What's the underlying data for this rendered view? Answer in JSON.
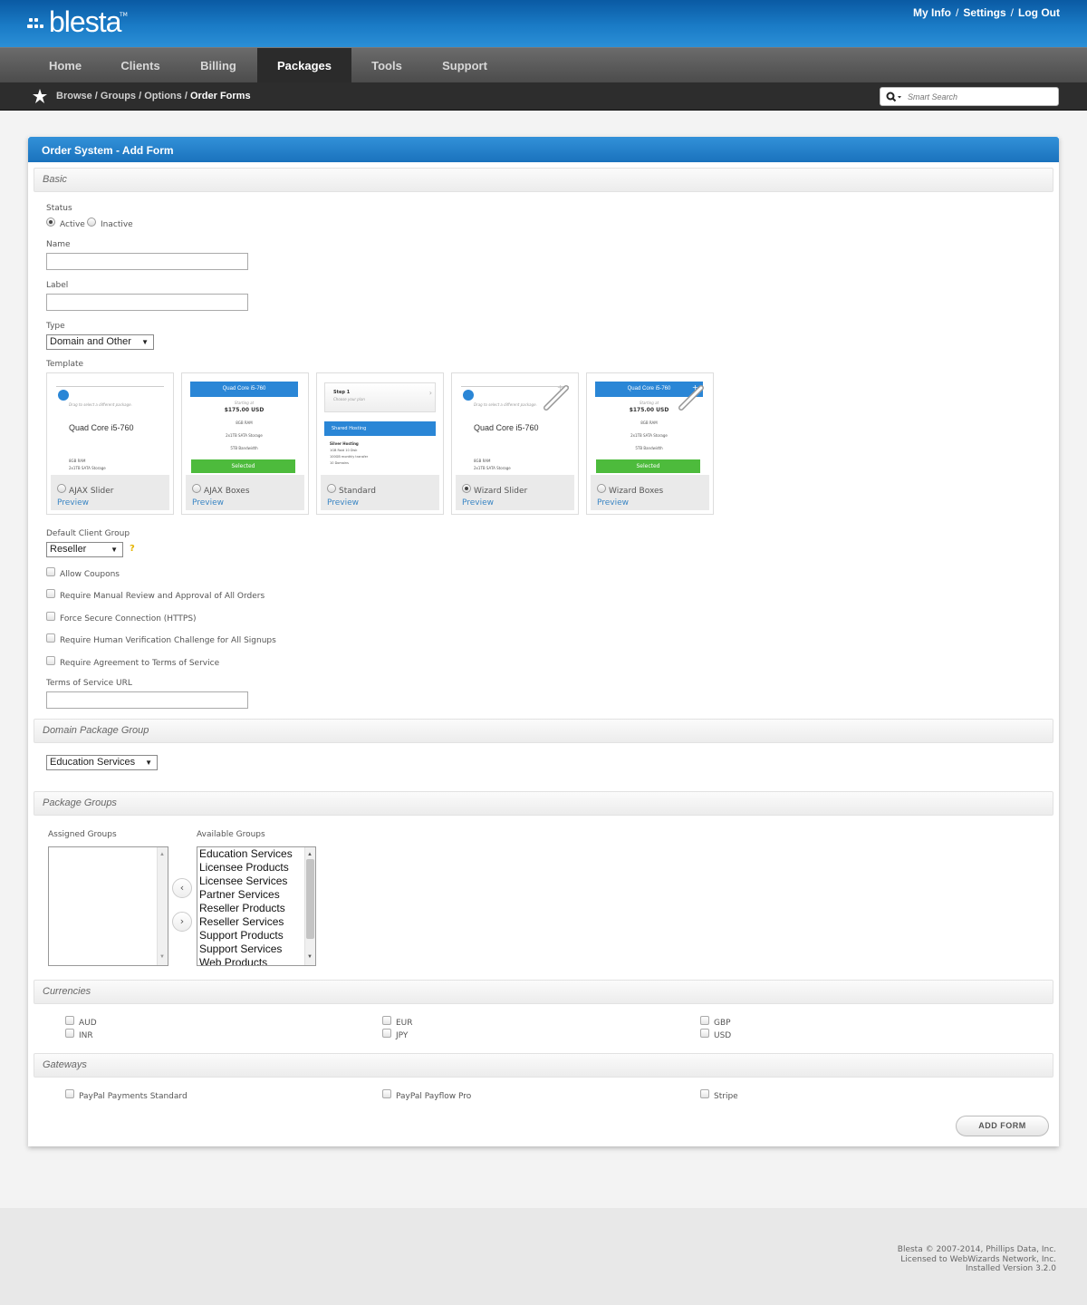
{
  "header": {
    "logo": "blesta",
    "logo_tm": "TM",
    "links": [
      "My Info",
      "Settings",
      "Log Out"
    ]
  },
  "nav": {
    "items": [
      "Home",
      "Clients",
      "Billing",
      "Packages",
      "Tools",
      "Support"
    ],
    "active": "Packages"
  },
  "breadcrumb": {
    "items": [
      "Browse",
      "Groups",
      "Options"
    ],
    "current": "Order Forms"
  },
  "search": {
    "placeholder": "Smart Search"
  },
  "panel": {
    "title": "Order System - Add Form"
  },
  "basic": {
    "section": "Basic",
    "status_label": "Status",
    "active_label": "Active",
    "inactive_label": "Inactive",
    "status_value": "Active",
    "name_label": "Name",
    "name_value": "",
    "label_label": "Label",
    "label_value": "",
    "type_label": "Type",
    "type_value": "Domain and Other",
    "template_label": "Template",
    "templates": [
      {
        "name": "AJAX Slider",
        "preview": "Preview",
        "selected": false
      },
      {
        "name": "AJAX Boxes",
        "preview": "Preview",
        "selected": false
      },
      {
        "name": "Standard",
        "preview": "Preview",
        "selected": false
      },
      {
        "name": "Wizard Slider",
        "preview": "Preview",
        "selected": true
      },
      {
        "name": "Wizard Boxes",
        "preview": "Preview",
        "selected": false
      }
    ],
    "tpl_preview": {
      "drag": "Drag to select a different package.",
      "product": "Quad Core i5-760",
      "ram": "8GB RAM",
      "storage_short": "2x1TB SATA Storage",
      "starting": "Starting at",
      "price": "$175.00 USD",
      "storage": "2x1TB SATA Storage",
      "bandwidth": "5TB Bandwidth",
      "selected": "Selected",
      "step": "Step 1",
      "choose": "Choose your plan",
      "shared": "Shared Hosting",
      "silver": "Silver Hosting",
      "disk": "1GB Raid 10 Disk",
      "transfer": "100GB monthly transfer",
      "domains": "10 Domains"
    },
    "client_group_label": "Default Client Group",
    "client_group_value": "Reseller",
    "help": "?",
    "checks": [
      "Allow Coupons",
      "Require Manual Review and Approval of All Orders",
      "Force Secure Connection (HTTPS)",
      "Require Human Verification Challenge for All Signups",
      "Require Agreement to Terms of Service"
    ],
    "tos_label": "Terms of Service URL",
    "tos_value": ""
  },
  "domain": {
    "section": "Domain Package Group",
    "value": "Education Services"
  },
  "groups": {
    "section": "Package Groups",
    "assigned_label": "Assigned Groups",
    "available_label": "Available Groups",
    "assigned": [],
    "available": [
      "Education Services",
      "Licensee Products",
      "Licensee Services",
      "Partner Services",
      "Reseller Products",
      "Reseller Services",
      "Support Products",
      "Support Services",
      "Web Products"
    ],
    "move_left": "‹",
    "move_right": "›"
  },
  "currencies": {
    "section": "Currencies",
    "items": [
      "AUD",
      "INR",
      "EUR",
      "JPY",
      "GBP",
      "USD"
    ]
  },
  "gateways": {
    "section": "Gateways",
    "items": [
      "PayPal Payments Standard",
      "PayPal Payflow Pro",
      "Stripe"
    ]
  },
  "submit": "ADD FORM",
  "footer": {
    "line1": "Blesta © 2007-2014, Phillips Data, Inc.",
    "line2": "Licensed to WebWizards Network, Inc.",
    "line3": "Installed Version 3.2.0"
  }
}
